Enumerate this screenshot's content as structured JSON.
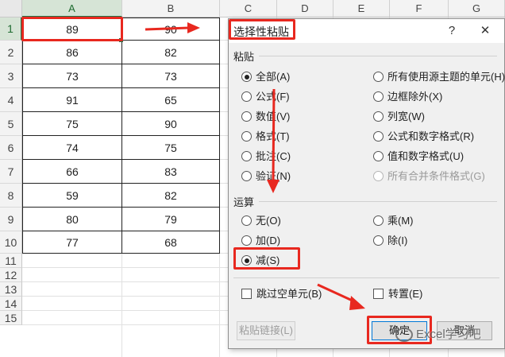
{
  "sheet": {
    "columns": [
      "A",
      "B",
      "C",
      "D",
      "E",
      "F",
      "G"
    ],
    "rows": [
      "1",
      "2",
      "3",
      "4",
      "5",
      "6",
      "7",
      "8",
      "9",
      "10",
      "11",
      "12",
      "13",
      "14",
      "15"
    ],
    "data": [
      [
        "89",
        "90"
      ],
      [
        "86",
        "82"
      ],
      [
        "73",
        "73"
      ],
      [
        "91",
        "65"
      ],
      [
        "75",
        "90"
      ],
      [
        "74",
        "75"
      ],
      [
        "66",
        "83"
      ],
      [
        "59",
        "82"
      ],
      [
        "80",
        "79"
      ],
      [
        "77",
        "68"
      ]
    ],
    "selected_column": "A",
    "selected_row": "1"
  },
  "dialog": {
    "title": "选择性粘贴",
    "help_label": "?",
    "close_label": "✕",
    "paste_section": "粘贴",
    "paste_options_left": [
      "全部(A)",
      "公式(F)",
      "数值(V)",
      "格式(T)",
      "批注(C)",
      "验证(N)"
    ],
    "paste_options_right": [
      "所有使用源主题的单元(H)",
      "边框除外(X)",
      "列宽(W)",
      "公式和数字格式(R)",
      "值和数字格式(U)",
      "所有合并条件格式(G)"
    ],
    "paste_selected": "全部(A)",
    "operation_section": "运算",
    "operation_left": [
      "无(O)",
      "加(D)",
      "减(S)"
    ],
    "operation_right": [
      "乘(M)",
      "除(I)"
    ],
    "operation_selected": "减(S)",
    "skip_blanks": "跳过空单元(B)",
    "transpose": "转置(E)",
    "paste_link_button": "粘贴链接(L)",
    "ok_button": "确定",
    "cancel_button": "取消"
  },
  "annotations": {
    "highlight_color": "#e8281f",
    "watermark": "Excel学习吧"
  },
  "icons": {
    "watermark": "wechat-icon",
    "close": "close-icon",
    "help": "help-icon"
  }
}
